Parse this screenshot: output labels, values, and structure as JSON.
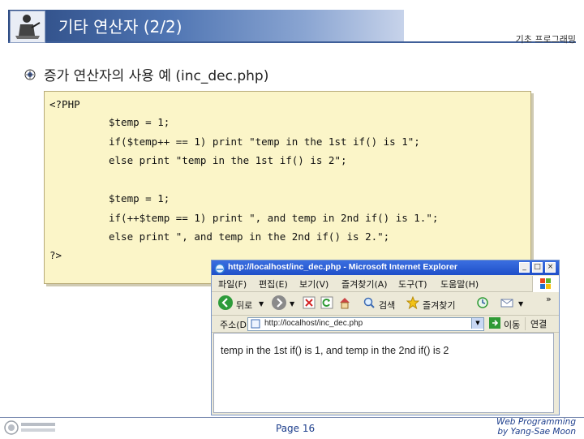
{
  "header": {
    "title": "기타 연산자 (2/2)",
    "course": "기초 프로그래밍"
  },
  "bullet": {
    "text": "증가 연산자의 사용 예 (inc_dec.php)"
  },
  "code": {
    "lines": [
      "<?PHP",
      "$temp = 1;",
      "if($temp++ == 1) print \"temp in the 1st if() is 1\";",
      "else print \"temp in the 1st if() is 2\";",
      "$temp = 1;",
      "if(++$temp == 1) print \", and temp in 2nd if() is 1.\";",
      "else print \", and temp in the 2nd if() is 2.\";",
      "?>"
    ]
  },
  "browser": {
    "title": "http://localhost/inc_dec.php - Microsoft Internet Explorer",
    "menu": [
      "파일(F)",
      "편집(E)",
      "보기(V)",
      "즐겨찾기(A)",
      "도구(T)",
      "도움말(H)"
    ],
    "toolbar": {
      "back_label": "뒤로",
      "search_label": "검색",
      "favorites_label": "즐겨찾기"
    },
    "address_label": "주소(D)",
    "address_value": "http://localhost/inc_dec.php",
    "go_label": "이동",
    "links_label": "연결",
    "chevron": "»",
    "output": "temp in the 1st if() is 1, and temp in the 2nd if() is 2"
  },
  "footer": {
    "page": "Page 16",
    "author_line1": "Web Programming",
    "author_line2": "by Yang-Sae Moon"
  }
}
